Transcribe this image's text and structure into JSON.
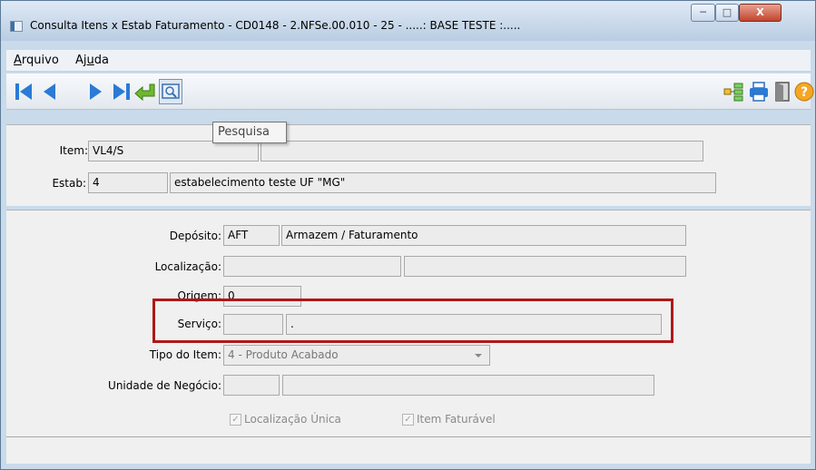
{
  "window": {
    "title": "Consulta Itens x Estab Faturamento - CD0148 - 2.NFSe.00.010 - 25 - .....: BASE TESTE :....."
  },
  "menu": [
    {
      "label_ul": "A",
      "label_rest": "rquivo"
    },
    {
      "label_pre": "Aj",
      "label_ul": "u",
      "label_rest": "da"
    }
  ],
  "toolbar": {
    "icons": [
      "first-icon",
      "prev-icon",
      "next-icon",
      "last-icon",
      "goto-icon",
      "search-icon",
      "list-icon",
      "print-icon",
      "exit-icon",
      "help-icon"
    ],
    "tooltip": "Pesquisa"
  },
  "header": {
    "item_label": "Item:",
    "item_value": "VL4/S",
    "item_desc": "",
    "estab_label": "Estab:",
    "estab_value": "4",
    "estab_desc": "estabelecimento teste UF \"MG\""
  },
  "details": {
    "deposito_label": "Depósito:",
    "deposito_code": "AFT",
    "deposito_desc": "Armazem / Faturamento",
    "localizacao_label": "Localização:",
    "localizacao_code": "",
    "localizacao_desc": "",
    "origem_label": "Origem:",
    "origem_value": "0",
    "servico_label": "Serviço:",
    "servico_code": "",
    "servico_desc": ".",
    "tipo_label": "Tipo do Item:",
    "tipo_value": "4 - Produto Acabado",
    "unidade_label": "Unidade de Negócio:",
    "unidade_code": "",
    "unidade_desc": "",
    "chk_localizacao": "Localização Única",
    "chk_faturavel": "Item Faturável",
    "check_mark": "✓"
  },
  "colors": {
    "highlight": "#b01818"
  }
}
